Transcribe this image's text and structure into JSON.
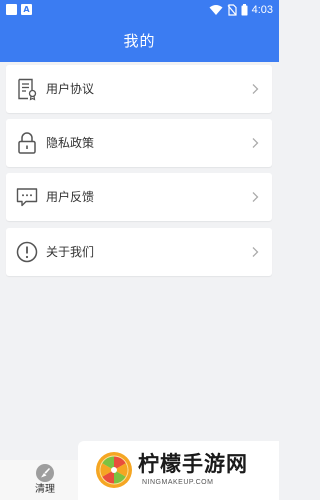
{
  "status_bar": {
    "time": "4:03",
    "left_icons": [
      "app-icon",
      "a-icon"
    ],
    "right_icons": [
      "wifi-icon",
      "no-sim-icon",
      "battery-icon"
    ]
  },
  "header": {
    "title": "我的"
  },
  "menu": {
    "items": [
      {
        "label": "用户协议",
        "icon": "document-icon"
      },
      {
        "label": "隐私政策",
        "icon": "lock-icon"
      },
      {
        "label": "用户反馈",
        "icon": "chat-icon"
      },
      {
        "label": "关于我们",
        "icon": "info-icon"
      }
    ]
  },
  "bottom_nav": {
    "clean_label": "清理",
    "clean_icon": "clean-icon"
  },
  "watermark": {
    "title": "柠檬手游网",
    "subtitle": "NINGMAKEUP.COM"
  },
  "colors": {
    "accent": "#3b7cf2",
    "background": "#f1f2f4",
    "card": "#ffffff",
    "text": "#333333"
  }
}
